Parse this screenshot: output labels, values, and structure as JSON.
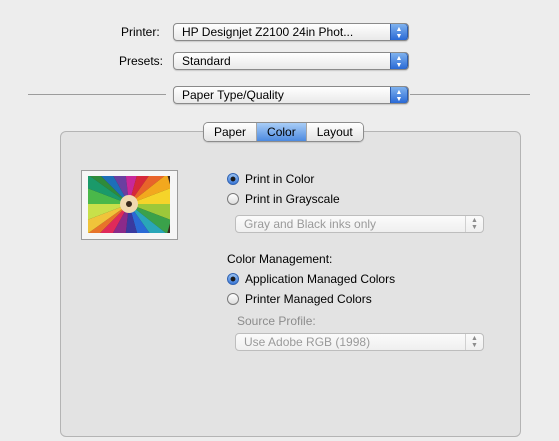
{
  "printer": {
    "label": "Printer:",
    "value": "HP Designjet Z2100 24in Phot..."
  },
  "presets": {
    "label": "Presets:",
    "value": "Standard"
  },
  "pane_menu": {
    "value": "Paper Type/Quality"
  },
  "tabs": [
    {
      "label": "Paper",
      "active": false
    },
    {
      "label": "Color",
      "active": true
    },
    {
      "label": "Layout",
      "active": false
    }
  ],
  "color": {
    "print_in_color": "Print in Color",
    "print_in_grayscale": "Print in Grayscale",
    "grayscale_option": "Gray and Black inks only",
    "mode": "color"
  },
  "management": {
    "label": "Color Management:",
    "app_managed": "Application Managed Colors",
    "printer_managed": "Printer Managed Colors",
    "source_profile_label": "Source Profile:",
    "source_profile_value": "Use Adobe RGB (1998)",
    "selected": "application"
  },
  "colors": {
    "accent": "#3b78d8",
    "panel": "#e3e3e3",
    "window": "#ededed",
    "disabled_text": "#8c8c8c"
  },
  "icons": {
    "popup": "up-down-arrows-icon",
    "preview": "color-pencils-image"
  }
}
